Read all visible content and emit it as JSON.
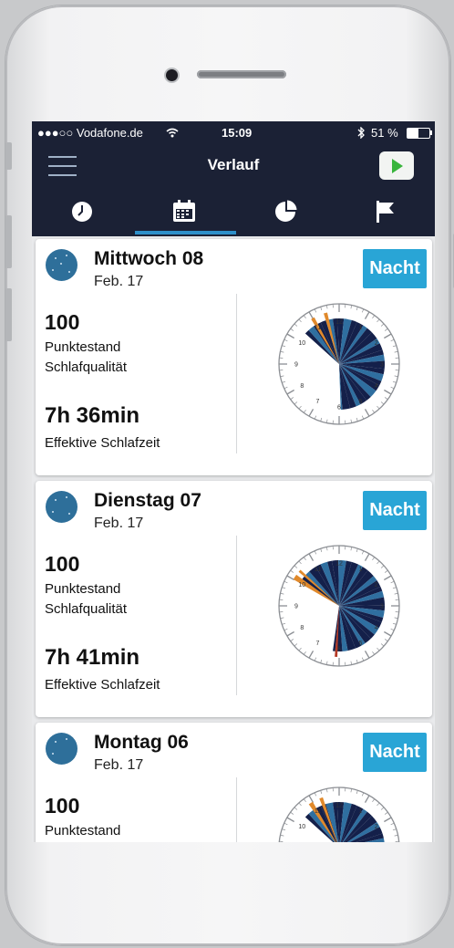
{
  "status": {
    "carrier": "●●●○○ Vodafone.de",
    "wifi_icon": "wifi-icon",
    "time": "15:09",
    "bluetooth_icon": "bluetooth-icon",
    "battery": "51 %"
  },
  "navbar": {
    "title": "Verlauf",
    "menu_icon": "hamburger-icon",
    "play_icon": "play-icon"
  },
  "tabs": [
    {
      "name": "clock",
      "icon": "clock-icon",
      "active": false
    },
    {
      "name": "calendar",
      "icon": "calendar-icon",
      "active": true
    },
    {
      "name": "stats",
      "icon": "pie-chart-icon",
      "active": false
    },
    {
      "name": "goals",
      "icon": "flag-icon",
      "active": false
    }
  ],
  "cards": [
    {
      "day": "Mittwoch 08",
      "date": "Feb. 17",
      "badge": "Nacht",
      "score": "100",
      "score_label1": "Punktestand",
      "score_label2": "Schlafqualität",
      "duration": "7h 36min",
      "duration_label": "Effektive Schlafzeit"
    },
    {
      "day": "Dienstag 07",
      "date": "Feb. 17",
      "badge": "Nacht",
      "score": "100",
      "score_label1": "Punktestand",
      "score_label2": "Schlafqualität",
      "duration": "7h 41min",
      "duration_label": "Effektive Schlafzeit"
    },
    {
      "day": "Montag 06",
      "date": "Feb. 17",
      "badge": "Nacht",
      "score": "100",
      "score_label1": "Punktestand"
    }
  ],
  "clock_numbers": [
    "12",
    "1",
    "2",
    "3",
    "4",
    "5",
    "6",
    "7",
    "8",
    "9",
    "10",
    "11"
  ],
  "colors": {
    "header_bg": "#1b2135",
    "accent": "#29a5d6",
    "sleep_deep": "#14204a",
    "sleep_light": "#2f6fa0",
    "awake_orange": "#e0892b",
    "marker_red": "#b43a26"
  }
}
